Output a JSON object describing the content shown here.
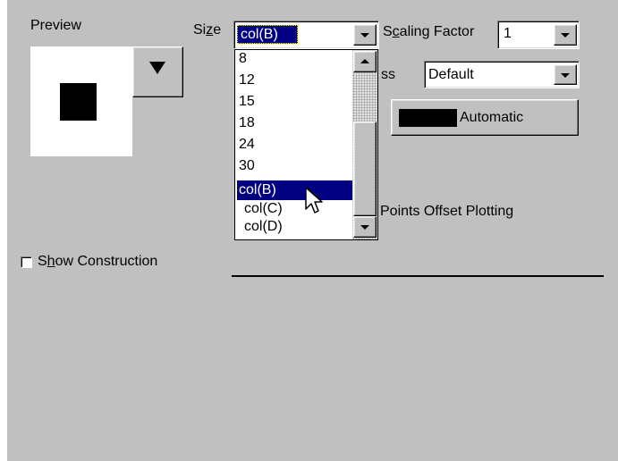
{
  "preview": {
    "label": "Preview"
  },
  "size": {
    "label_pre": "Si",
    "label_underline": "z",
    "label_post": "e",
    "selected": "col(B)",
    "options": [
      "8",
      "12",
      "15",
      "18",
      "24",
      "30",
      "col(B)",
      "col(C)",
      "col(D)"
    ],
    "highlighted_index": 6
  },
  "scaling": {
    "label_pre": "S",
    "label_underline": "c",
    "label_post": "aling Factor",
    "value": "1"
  },
  "edge": {
    "label_partial": "ss",
    "value": "Default"
  },
  "color_button": {
    "label": "Automatic",
    "swatch_color": "#000000"
  },
  "points_offset": {
    "label": "Points Offset Plotting"
  },
  "show_construction": {
    "label_pre": "S",
    "label_underline": "h",
    "label_post": "ow Construction",
    "checked": false
  },
  "colors": {
    "dialog_bg": "#c0c0c0",
    "selection_bg": "#000080",
    "selection_fg": "#ffffff"
  }
}
